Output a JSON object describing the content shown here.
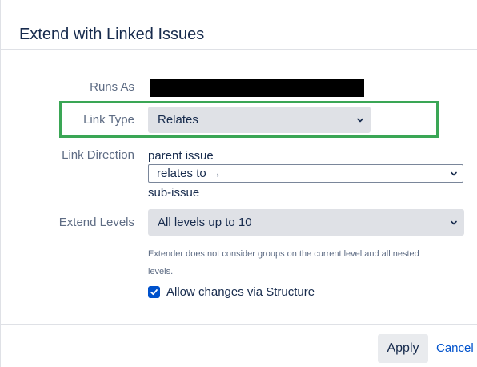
{
  "dialog": {
    "title": "Extend with Linked Issues"
  },
  "form": {
    "runs_as": {
      "label": "Runs As"
    },
    "link_type": {
      "label": "Link Type",
      "selected": "Relates"
    },
    "link_direction": {
      "label": "Link Direction",
      "above_text": "parent issue",
      "selected": "relates to →",
      "below_text": "sub-issue"
    },
    "extend_levels": {
      "label": "Extend Levels",
      "selected": "All levels up to 10",
      "helper_line1": "Extender does not consider groups on the current level and all nested",
      "helper_line2": "levels."
    },
    "allow_changes": {
      "label": "Allow changes via Structure",
      "checked": true
    }
  },
  "footer": {
    "apply_label": "Apply",
    "cancel_label": "Cancel"
  },
  "colors": {
    "highlight": "#3aa655",
    "checkbox": "#0052cc",
    "link": "#0052cc"
  },
  "icons": {
    "select_arrow": "chevron-down-icon",
    "checkbox_mark": "checkmark-icon"
  }
}
